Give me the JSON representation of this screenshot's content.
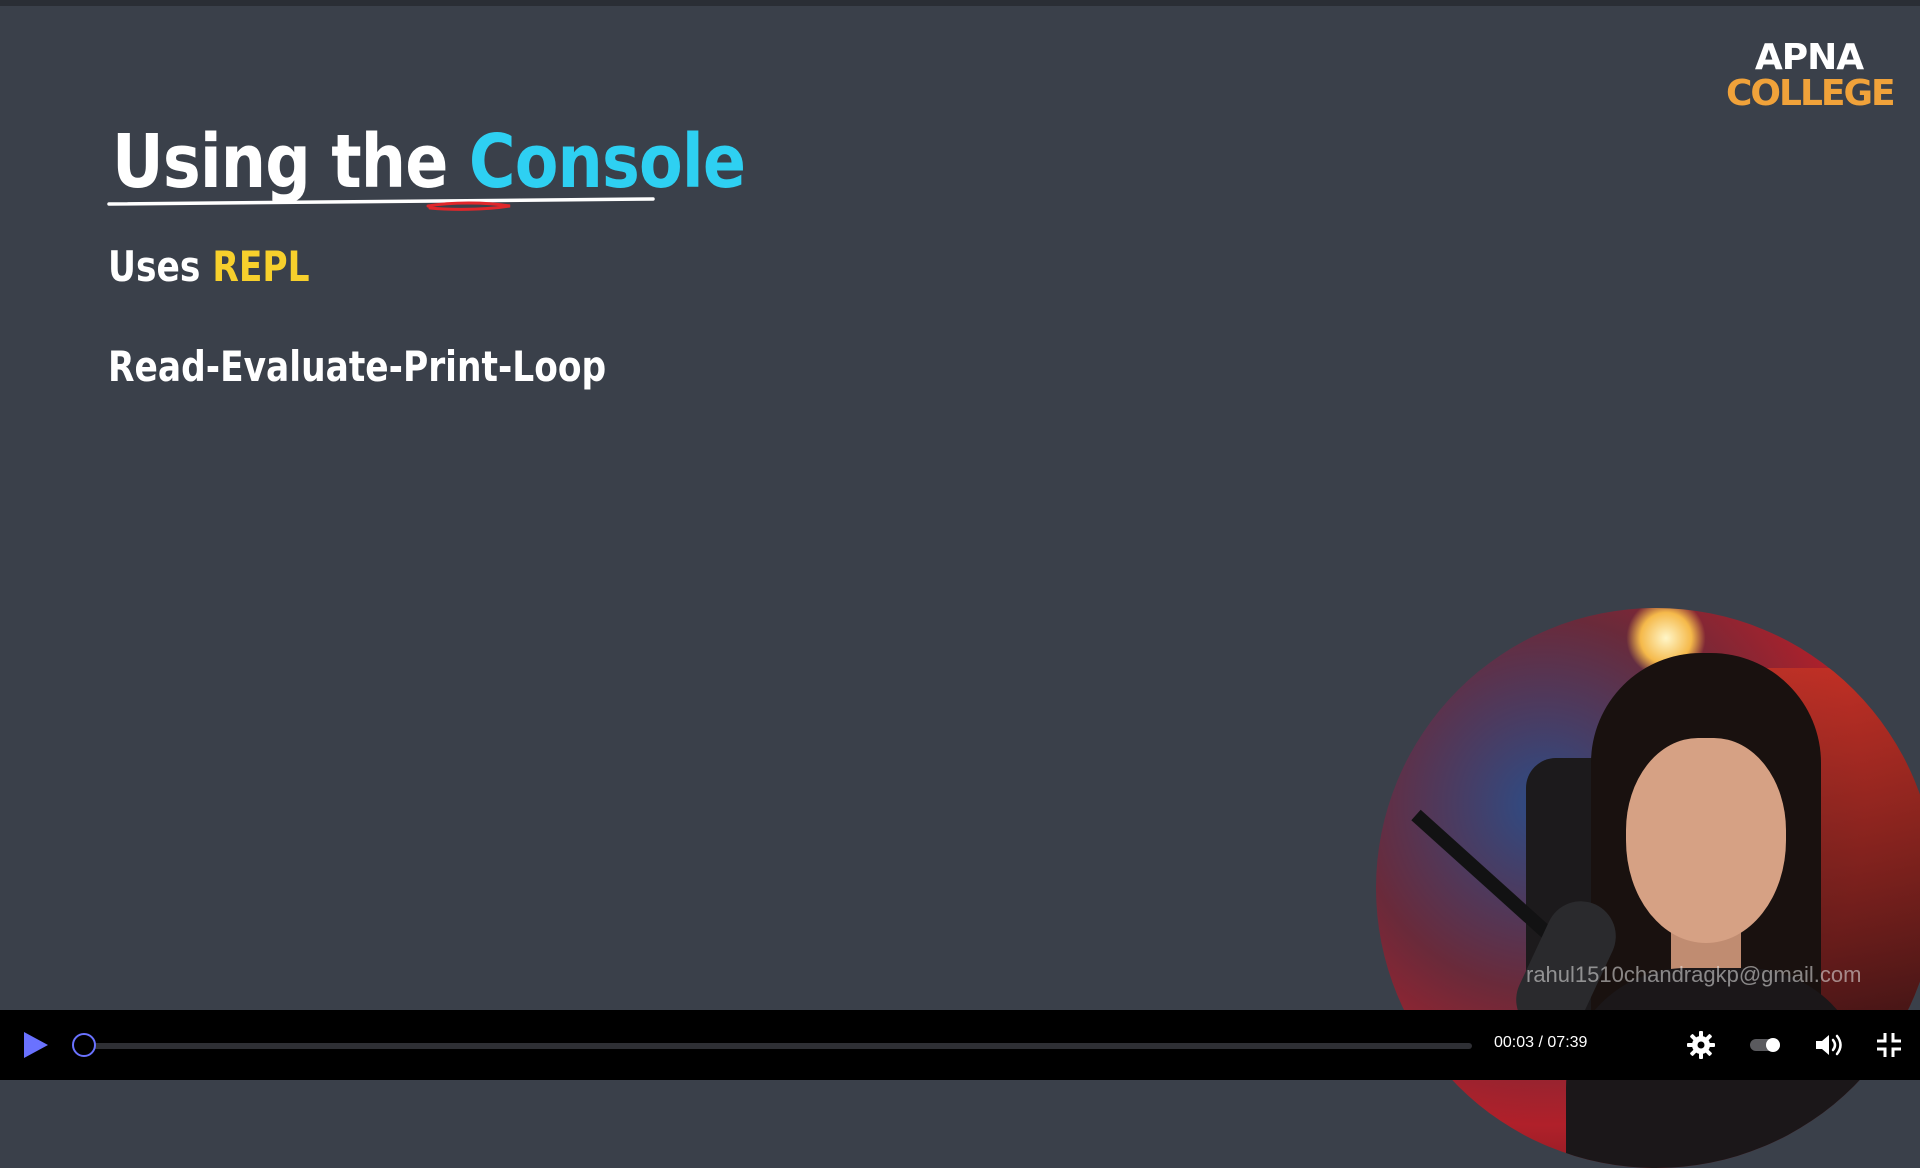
{
  "slide": {
    "title_prefix": "Using the",
    "title_highlight": "Console",
    "line1_prefix": "Uses",
    "line1_highlight": "REPL",
    "line2": "Read-Evaluate-Print-Loop",
    "colors": {
      "background": "#3a404a",
      "title_accent": "#2ed0f2",
      "highlight": "#f7d02c",
      "annotation": "#e0272b"
    }
  },
  "logo": {
    "line1": "APNA",
    "line2": "COLLEGE"
  },
  "webcam": {
    "watermark": "rahul1510chandragkp@gmail.com"
  },
  "player": {
    "current_time": "00:03",
    "separator": "/",
    "duration": "07:39",
    "progress": 0.0065,
    "icons": [
      "play-icon",
      "gear-icon",
      "toggle-icon",
      "volume-icon",
      "exit-fullscreen-icon"
    ],
    "accent": "#6a72ff"
  }
}
